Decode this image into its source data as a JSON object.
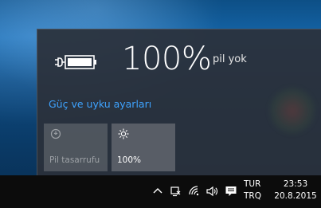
{
  "battery": {
    "percent": "100%",
    "status": "pil yok"
  },
  "power_settings_link": "Güç ve uyku ayarları",
  "tiles": {
    "battery_saver": "Pil tasarrufu",
    "brightness": "100%"
  },
  "taskbar": {
    "language_line1": "TUR",
    "language_line2": "TRQ",
    "time": "23:53",
    "date": "20.8.2015"
  },
  "colors": {
    "accent": "#3ea3ff",
    "flyout_bg": "#2b303a",
    "taskbar_bg": "#0c0c0c"
  },
  "icons": [
    "battery-plugged-icon",
    "battery-saver-icon",
    "brightness-icon",
    "chevron-up-icon",
    "network-icon",
    "wifi-icon",
    "volume-icon",
    "action-center-icon"
  ]
}
